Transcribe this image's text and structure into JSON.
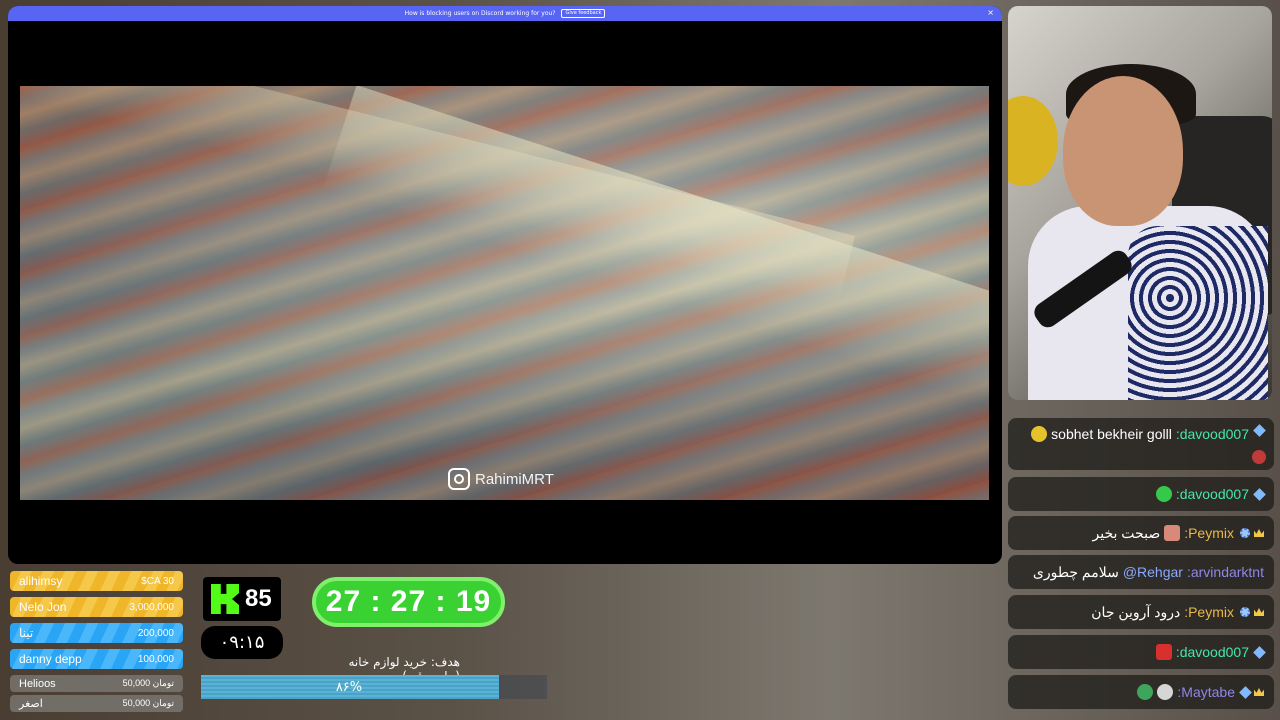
{
  "notice": {
    "text": "How is blocking users on Discord working for you?",
    "button": "Give feedback",
    "close": "×"
  },
  "video": {
    "watermark": "RahimiMRT"
  },
  "chat": [
    {
      "user": ":davood007",
      "text": "sobhet bekheir golll",
      "user_color": "#46e6a8"
    },
    {
      "user": ":davood007",
      "text": "",
      "user_color": "#46e6a8"
    },
    {
      "user": ":Peymix",
      "text": "صبحت بخیر",
      "user_color": "#e8b84a"
    },
    {
      "user": ":arvindarktnt",
      "mention": "@Rehgar",
      "text": "سلامم چطوری",
      "user_color": "#8f86e8"
    },
    {
      "user": ":Peymix",
      "text": "درود آروین جان",
      "user_color": "#e8b84a"
    },
    {
      "user": ":davood007",
      "text": "",
      "user_color": "#46e6a8"
    },
    {
      "user": ":Maytabe",
      "text": "",
      "user_color": "#8f86e8"
    }
  ],
  "donations": [
    {
      "name": "alihimsy",
      "amount": "$CA 30"
    },
    {
      "name": "Nelo Jon",
      "amount": "3,000,000"
    },
    {
      "name": "تینا",
      "amount": "200,000"
    },
    {
      "name": "danny depp",
      "amount": "100,000"
    },
    {
      "name": "Helioos",
      "amount": "50,000 تومان"
    },
    {
      "name": "اصغر",
      "amount": "50,000 تومان"
    }
  ],
  "kick": {
    "count": "85"
  },
  "clock": "۰۹:۱۵",
  "timer": "27 : 27 : 19",
  "goal": {
    "label": "هدف: خرید لوازم خانه (جاروبرقی)",
    "percent_text": "۸۶%",
    "progress": 0.86
  },
  "colors": {
    "notice_bar": "#5865f2",
    "kick_green": "#53fc18",
    "timer_green": "#3ad132"
  }
}
